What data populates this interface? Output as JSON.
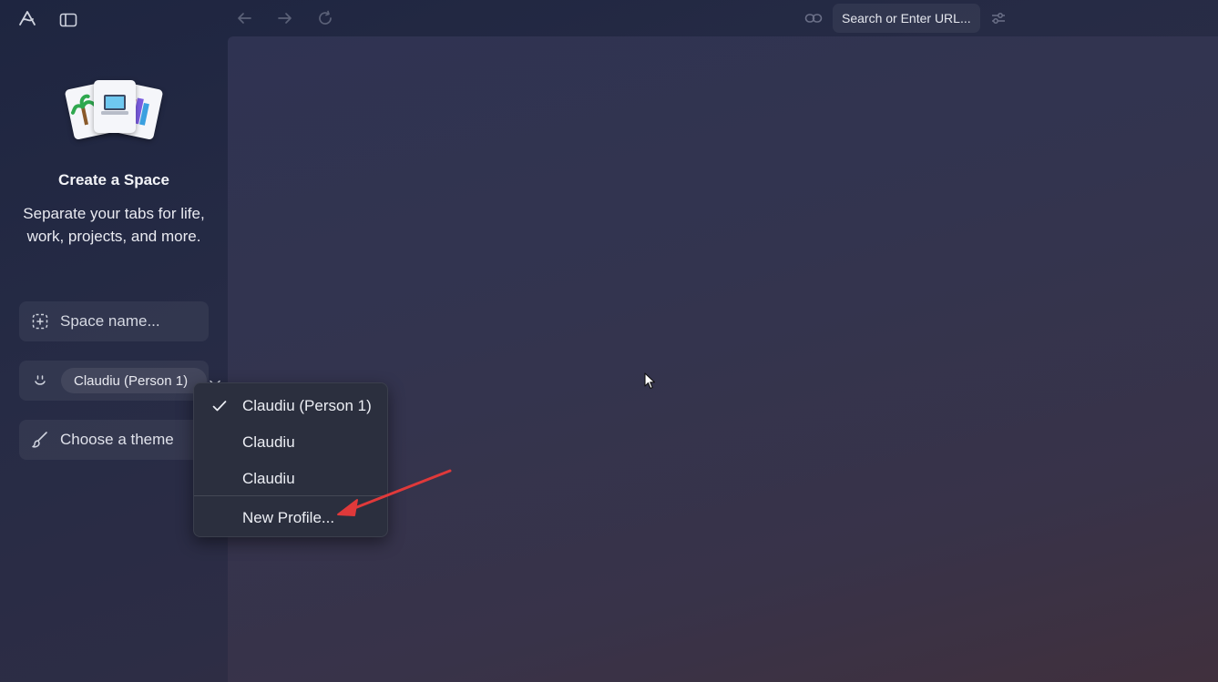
{
  "topbar": {
    "url_placeholder": "Search or Enter URL..."
  },
  "sidebar": {
    "title": "Create a Space",
    "subtitle": "Separate your tabs for life, work, projects, and more.",
    "space_name_placeholder": "Space name...",
    "profile_selected": "Claudiu (Person 1)",
    "theme_label": "Choose a theme"
  },
  "profile_menu": {
    "items": [
      {
        "label": "Claudiu (Person 1)",
        "checked": true
      },
      {
        "label": "Claudiu",
        "checked": false
      },
      {
        "label": "Claudiu",
        "checked": false
      }
    ],
    "new_profile_label": "New Profile..."
  },
  "colors": {
    "annotation_arrow": "#e0393a",
    "menu_bg": "#2b2f3e"
  },
  "icons": [
    "arc-logo-icon",
    "sidebar-toggle-icon",
    "back-arrow-icon",
    "forward-arrow-icon",
    "reload-icon",
    "link-icon",
    "sliders-icon",
    "space-icon",
    "smiley-icon",
    "chevron-down-icon",
    "brush-icon",
    "check-icon"
  ]
}
